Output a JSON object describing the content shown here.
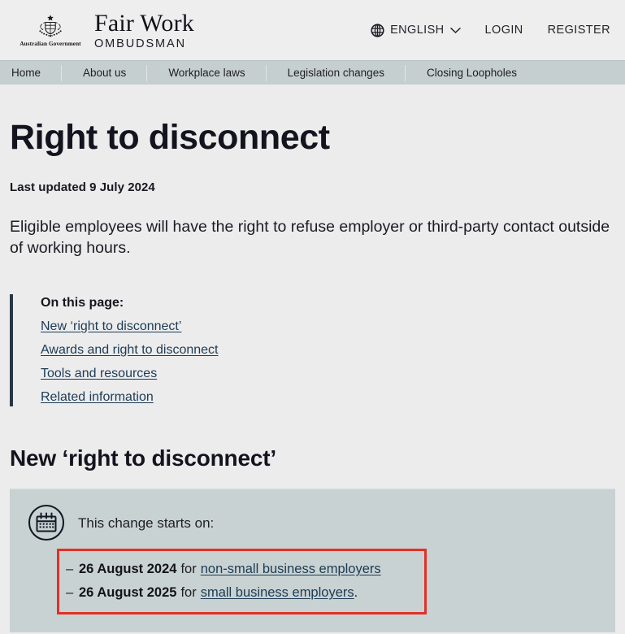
{
  "header": {
    "crest_text": "Australian Government",
    "crest_icon": "australian-coat-of-arms",
    "wordmark_top": "Fair Work",
    "wordmark_bottom": "OMBUDSMAN",
    "globe_icon": "globe-icon",
    "language": "ENGLISH",
    "chevron_icon": "chevron-down-icon",
    "login": "LOGIN",
    "register": "REGISTER"
  },
  "nav": {
    "items": [
      {
        "label": "Home"
      },
      {
        "label": "About us"
      },
      {
        "label": "Workplace laws"
      },
      {
        "label": "Legislation changes"
      },
      {
        "label": "Closing Loopholes"
      }
    ]
  },
  "main": {
    "title": "Right to disconnect",
    "last_updated": "Last updated 9 July 2024",
    "intro": "Eligible employees will have the right to refuse employer or third-party contact outside of working hours.",
    "on_this_page": {
      "title": "On this page:",
      "links": [
        {
          "label": "New ‘right to disconnect’"
        },
        {
          "label": "Awards and right to disconnect"
        },
        {
          "label": "Tools and resources"
        },
        {
          "label": "Related information"
        }
      ]
    },
    "section_heading": "New ‘right to disconnect’",
    "callout": {
      "icon": "calendar-icon",
      "heading": "This change starts on:",
      "dates": [
        {
          "dash": "–",
          "date": "26 August 2024",
          "connector": "for",
          "link": "non-small business employers",
          "period": ""
        },
        {
          "dash": "–",
          "date": "26 August 2025",
          "connector": "for",
          "link": "small business employers",
          "period": "."
        }
      ]
    }
  },
  "colors": {
    "page_background": "#ececed",
    "header_background": "#eeeeee",
    "nav_background": "#c6cfcf",
    "callout_background": "#c9d2d2",
    "highlight_border": "#e03127",
    "link": "#1c3b54",
    "accent_rule": "#273746"
  }
}
